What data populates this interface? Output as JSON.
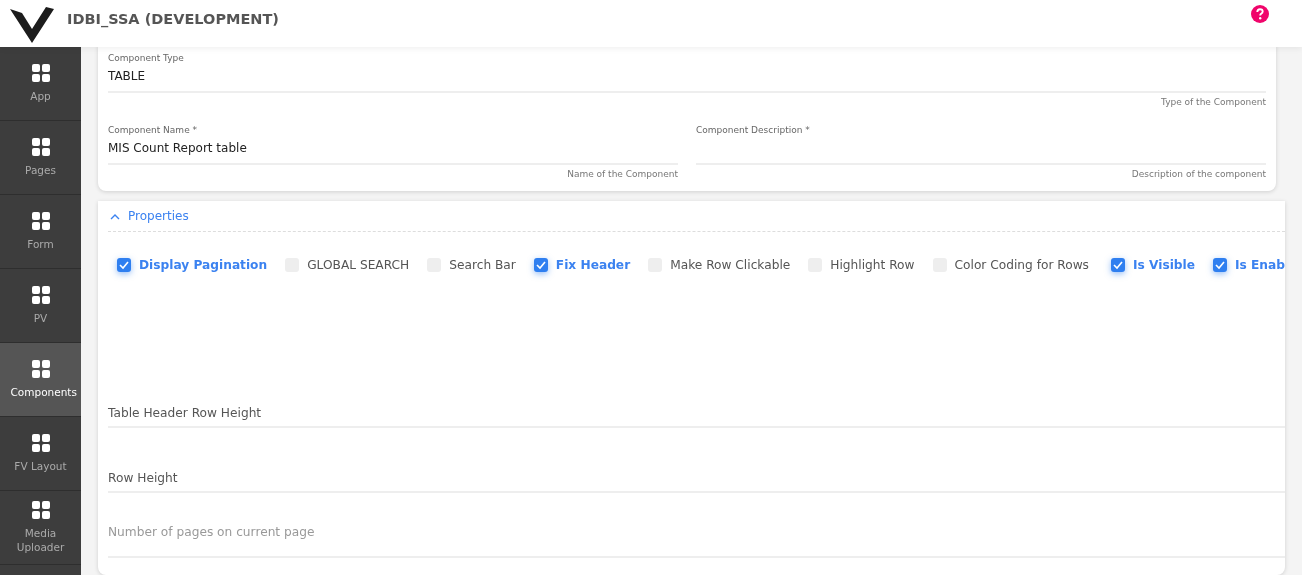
{
  "header": {
    "title": "IDBI_SSA (DEVELOPMENT)"
  },
  "sidebar": {
    "items": [
      {
        "label": "App",
        "selected": false
      },
      {
        "label": "Pages",
        "selected": false
      },
      {
        "label": "Form",
        "selected": false
      },
      {
        "label": "PV",
        "selected": false
      },
      {
        "label": "Components",
        "selected": true
      },
      {
        "label": "FV Layout",
        "selected": false
      },
      {
        "label": "Media Uploader",
        "selected": false
      }
    ]
  },
  "details": {
    "rows": [
      [
        {
          "label": "Component Type",
          "value": "TABLE",
          "hint": "Type of the Component"
        }
      ],
      [
        {
          "label": "Component Name *",
          "value": "MIS Count Report table",
          "hint": "Name of the Component"
        },
        {
          "label": "Component Description *",
          "hint": "Description of the component"
        }
      ]
    ]
  },
  "properties": {
    "title": "Properties",
    "expanded": true,
    "options": [
      {
        "label": "Display Pagination",
        "checked": true
      },
      {
        "label": "GLOBAL SEARCH",
        "checked": false
      },
      {
        "label": "Search Bar",
        "checked": false
      },
      {
        "label": "Fix Header",
        "checked": true
      },
      {
        "label": "Make Row Clickable",
        "checked": false
      },
      {
        "label": "Highlight Row",
        "checked": false
      },
      {
        "label": "Color Coding for Rows",
        "checked": false
      }
    ],
    "status_options": [
      {
        "label": "Is Visible",
        "checked": true
      },
      {
        "label": "Is Enab",
        "checked": true
      }
    ],
    "fields": [
      {
        "label": "Table Header Row Height"
      },
      {
        "label": "Row Height"
      },
      {
        "placeholder": "Number of pages on current page"
      }
    ]
  }
}
